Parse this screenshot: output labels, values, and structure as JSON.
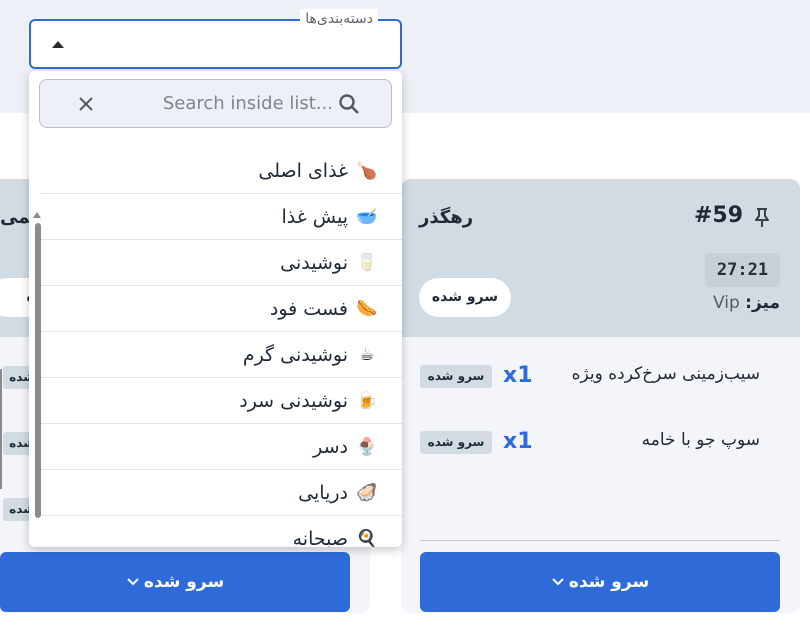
{
  "filter": {
    "label": "دسته‌بندی‌ها",
    "search_placeholder": "Search inside list...",
    "categories": [
      {
        "label": "غذای اصلی",
        "icon": "drumstick-icon",
        "emoji": "🍗"
      },
      {
        "label": "پیش غذا",
        "icon": "soup-bowl-icon",
        "emoji": "🥣"
      },
      {
        "label": "نوشیدنی",
        "icon": "glass-icon",
        "emoji": "🥛"
      },
      {
        "label": "فست فود",
        "icon": "hotdog-icon",
        "emoji": "🌭"
      },
      {
        "label": "نوشیدنی گرم",
        "icon": "hot-drink-icon",
        "emoji": "☕"
      },
      {
        "label": "نوشیدنی سرد",
        "icon": "beer-mug-icon",
        "emoji": "🍺"
      },
      {
        "label": "دسر",
        "icon": "dessert-icon",
        "emoji": "🍨"
      },
      {
        "label": "دریایی",
        "icon": "oyster-icon",
        "emoji": "🦪"
      },
      {
        "label": "صبحانه",
        "icon": "frying-pan-icon",
        "emoji": "🍳"
      }
    ]
  },
  "orders": [
    {
      "number": "#59",
      "waiter": "رهگذر",
      "timer": "27:21",
      "table_label": "میز:",
      "table_value": "Vip",
      "status": "سرو شده",
      "items": [
        {
          "name": "سیب‌زمینی سرخ‌کرده ویژه",
          "qty": "x1",
          "status": "سرو شده"
        },
        {
          "name": "سوپ جو با خامه",
          "qty": "x1",
          "status": "سرو شده"
        }
      ],
      "action": "سرو شده"
    },
    {
      "title_fragment": "ریمی",
      "status_fragment": "ده",
      "item_status_fragments": [
        "شده",
        "شده",
        "شده"
      ],
      "action": "سرو شده"
    }
  ],
  "colors": {
    "primary": "#2e6bd9",
    "header_bg": "#d2dae2",
    "page_band": "#eef0f7",
    "card_bg": "#f4f5fa"
  }
}
